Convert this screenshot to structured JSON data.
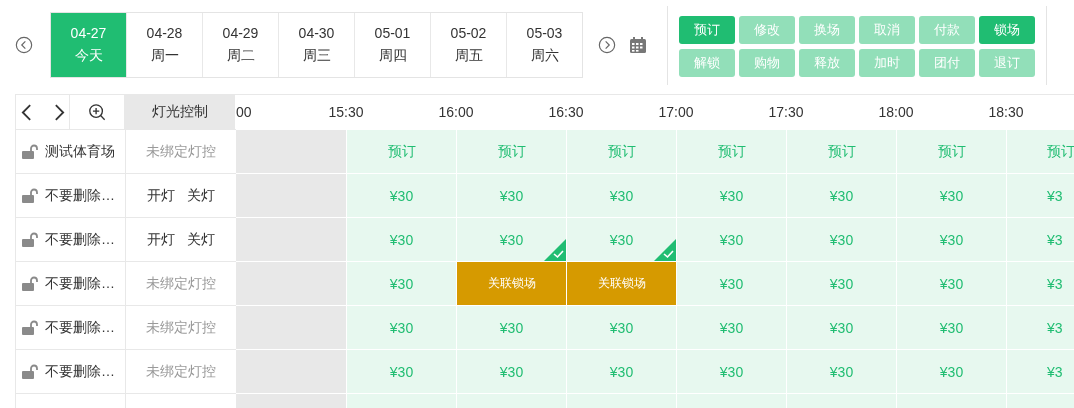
{
  "dates": [
    {
      "date": "04-27",
      "weekday": "今天",
      "selected": true
    },
    {
      "date": "04-28",
      "weekday": "周一",
      "selected": false
    },
    {
      "date": "04-29",
      "weekday": "周二",
      "selected": false
    },
    {
      "date": "04-30",
      "weekday": "周三",
      "selected": false
    },
    {
      "date": "05-01",
      "weekday": "周四",
      "selected": false
    },
    {
      "date": "05-02",
      "weekday": "周五",
      "selected": false
    },
    {
      "date": "05-03",
      "weekday": "周六",
      "selected": false
    }
  ],
  "actions": [
    {
      "label": "预订",
      "disabled": false
    },
    {
      "label": "修改",
      "disabled": true
    },
    {
      "label": "换场",
      "disabled": true
    },
    {
      "label": "取消",
      "disabled": true
    },
    {
      "label": "付款",
      "disabled": true
    },
    {
      "label": "锁场",
      "disabled": false
    },
    {
      "label": "解锁",
      "disabled": true
    },
    {
      "label": "购物",
      "disabled": true
    },
    {
      "label": "释放",
      "disabled": true
    },
    {
      "label": "加时",
      "disabled": true
    },
    {
      "label": "团付",
      "disabled": true
    },
    {
      "label": "退订",
      "disabled": true
    }
  ],
  "grid": {
    "light_control_header": "灯光控制",
    "times": [
      "00",
      "15:30",
      "16:00",
      "16:30",
      "17:00",
      "17:30",
      "18:00",
      "18:30"
    ],
    "rows": [
      {
        "name": "测试体育场",
        "locked": false,
        "light": {
          "kind": "unbound",
          "text": "未绑定灯控"
        },
        "slots": [
          {
            "kind": "past"
          },
          {
            "kind": "free",
            "text": "预订",
            "checked": false
          },
          {
            "kind": "free",
            "text": "预订",
            "checked": false
          },
          {
            "kind": "free",
            "text": "预订",
            "checked": false
          },
          {
            "kind": "free",
            "text": "预订",
            "checked": false
          },
          {
            "kind": "free",
            "text": "预订",
            "checked": false
          },
          {
            "kind": "free",
            "text": "预订",
            "checked": false
          },
          {
            "kind": "free",
            "text": "预订",
            "checked": false
          }
        ]
      },
      {
        "name": "不要删除…",
        "locked": false,
        "light": {
          "kind": "switch",
          "on": "开灯",
          "off": "关灯"
        },
        "slots": [
          {
            "kind": "past"
          },
          {
            "kind": "free",
            "text": "¥30",
            "checked": false
          },
          {
            "kind": "free",
            "text": "¥30",
            "checked": false
          },
          {
            "kind": "free",
            "text": "¥30",
            "checked": false
          },
          {
            "kind": "free",
            "text": "¥30",
            "checked": false
          },
          {
            "kind": "free",
            "text": "¥30",
            "checked": false
          },
          {
            "kind": "free",
            "text": "¥30",
            "checked": false
          },
          {
            "kind": "free",
            "text": "¥3",
            "checked": false
          }
        ]
      },
      {
        "name": "不要删除…",
        "locked": false,
        "light": {
          "kind": "switch",
          "on": "开灯",
          "off": "关灯"
        },
        "slots": [
          {
            "kind": "past"
          },
          {
            "kind": "free",
            "text": "¥30",
            "checked": false
          },
          {
            "kind": "free",
            "text": "¥30",
            "checked": true
          },
          {
            "kind": "free",
            "text": "¥30",
            "checked": true
          },
          {
            "kind": "free",
            "text": "¥30",
            "checked": false
          },
          {
            "kind": "free",
            "text": "¥30",
            "checked": false
          },
          {
            "kind": "free",
            "text": "¥30",
            "checked": false
          },
          {
            "kind": "free",
            "text": "¥3",
            "checked": false
          }
        ]
      },
      {
        "name": "不要删除…",
        "locked": false,
        "light": {
          "kind": "unbound",
          "text": "未绑定灯控"
        },
        "slots": [
          {
            "kind": "past"
          },
          {
            "kind": "free",
            "text": "¥30",
            "checked": false
          },
          {
            "kind": "linked_lock",
            "text": "关联锁场",
            "checked": false
          },
          {
            "kind": "linked_lock",
            "text": "关联锁场",
            "checked": false
          },
          {
            "kind": "free",
            "text": "¥30",
            "checked": false
          },
          {
            "kind": "free",
            "text": "¥30",
            "checked": false
          },
          {
            "kind": "free",
            "text": "¥30",
            "checked": false
          },
          {
            "kind": "free",
            "text": "¥3",
            "checked": false
          }
        ]
      },
      {
        "name": "不要删除…",
        "locked": false,
        "light": {
          "kind": "unbound",
          "text": "未绑定灯控"
        },
        "slots": [
          {
            "kind": "past"
          },
          {
            "kind": "free",
            "text": "¥30",
            "checked": false
          },
          {
            "kind": "free",
            "text": "¥30",
            "checked": false
          },
          {
            "kind": "free",
            "text": "¥30",
            "checked": false
          },
          {
            "kind": "free",
            "text": "¥30",
            "checked": false
          },
          {
            "kind": "free",
            "text": "¥30",
            "checked": false
          },
          {
            "kind": "free",
            "text": "¥30",
            "checked": false
          },
          {
            "kind": "free",
            "text": "¥3",
            "checked": false
          }
        ]
      },
      {
        "name": "不要删除…",
        "locked": false,
        "light": {
          "kind": "unbound",
          "text": "未绑定灯控"
        },
        "slots": [
          {
            "kind": "past"
          },
          {
            "kind": "free",
            "text": "¥30",
            "checked": false
          },
          {
            "kind": "free",
            "text": "¥30",
            "checked": false
          },
          {
            "kind": "free",
            "text": "¥30",
            "checked": false
          },
          {
            "kind": "free",
            "text": "¥30",
            "checked": false
          },
          {
            "kind": "free",
            "text": "¥30",
            "checked": false
          },
          {
            "kind": "free",
            "text": "¥30",
            "checked": false
          },
          {
            "kind": "free",
            "text": "¥3",
            "checked": false
          }
        ]
      }
    ]
  }
}
